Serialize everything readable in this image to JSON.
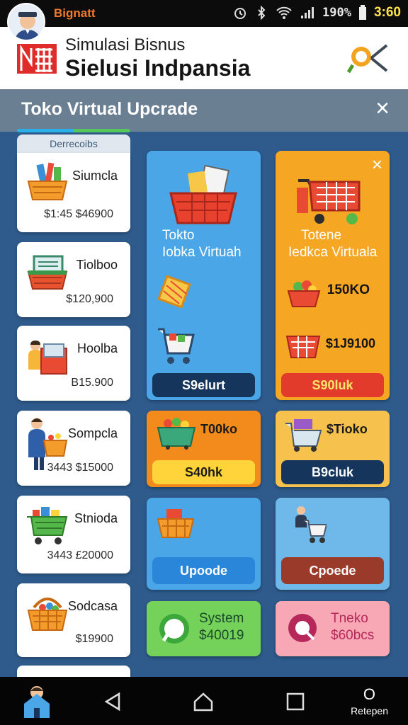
{
  "status": {
    "app_name": "Bignatt",
    "battery_text": "190%",
    "time": "3:60"
  },
  "header": {
    "title_top": "Simulasi Bisnus",
    "title_main": "Sielusi Indpansia"
  },
  "section": {
    "title": "Toko Virtual Upcrade",
    "close_glyph": "×"
  },
  "left_list": {
    "header": "Derrecoibs",
    "items": [
      {
        "name": "Siumcla",
        "price": "$1:45 $46900",
        "icon": "basket-tools-icon"
      },
      {
        "name": "Tiolboo",
        "price": "$120,900",
        "icon": "basket-register-icon"
      },
      {
        "name": "Hoolba",
        "price": "B15.900",
        "icon": "shopkeeper-icon"
      },
      {
        "name": "Sompcla",
        "price": "3443 $15000",
        "icon": "businessman-basket-icon"
      },
      {
        "name": "Stnioda",
        "price": "3443 £20000",
        "icon": "shopping-cart-icon"
      },
      {
        "name": "Sodcasa",
        "price": "$19900",
        "icon": "grocery-basket-icon"
      }
    ]
  },
  "tiles": {
    "blue_big": {
      "label_line1": "Tokto",
      "label_line2": "Iobka Virtuah",
      "button": "S9elurt"
    },
    "orange_big": {
      "label_line1": "Totene",
      "label_line2": "Iedkca Virtuala",
      "value1": "150KO",
      "value2": "$1J9100",
      "button": "S90luk",
      "close_glyph": "×"
    },
    "orange_small": {
      "label": "T00ko",
      "button": "S40hk"
    },
    "yellow_small": {
      "label": "$Tioko",
      "button": "B9cluk"
    },
    "blue_small": {
      "button": "Upoode"
    },
    "lightblue_small": {
      "button": "Cpoede"
    },
    "green_small": {
      "line1": "System",
      "line2": "$40019"
    },
    "pink_small": {
      "line1": "Tneko",
      "line2": "$60bcs"
    }
  },
  "nav": {
    "right_label": "Retepen",
    "right_glyph": "O"
  },
  "colors": {
    "background": "#2e5b8c",
    "header_bar": "#6b7f93",
    "tile_blue": "#4aa6e6",
    "tile_orange": "#f5a623",
    "tile_green": "#74d15a",
    "tile_pink": "#f7a8b4",
    "button_navy": "#15355c",
    "button_red": "#e23b2b",
    "button_yellow": "#ffd43a"
  }
}
